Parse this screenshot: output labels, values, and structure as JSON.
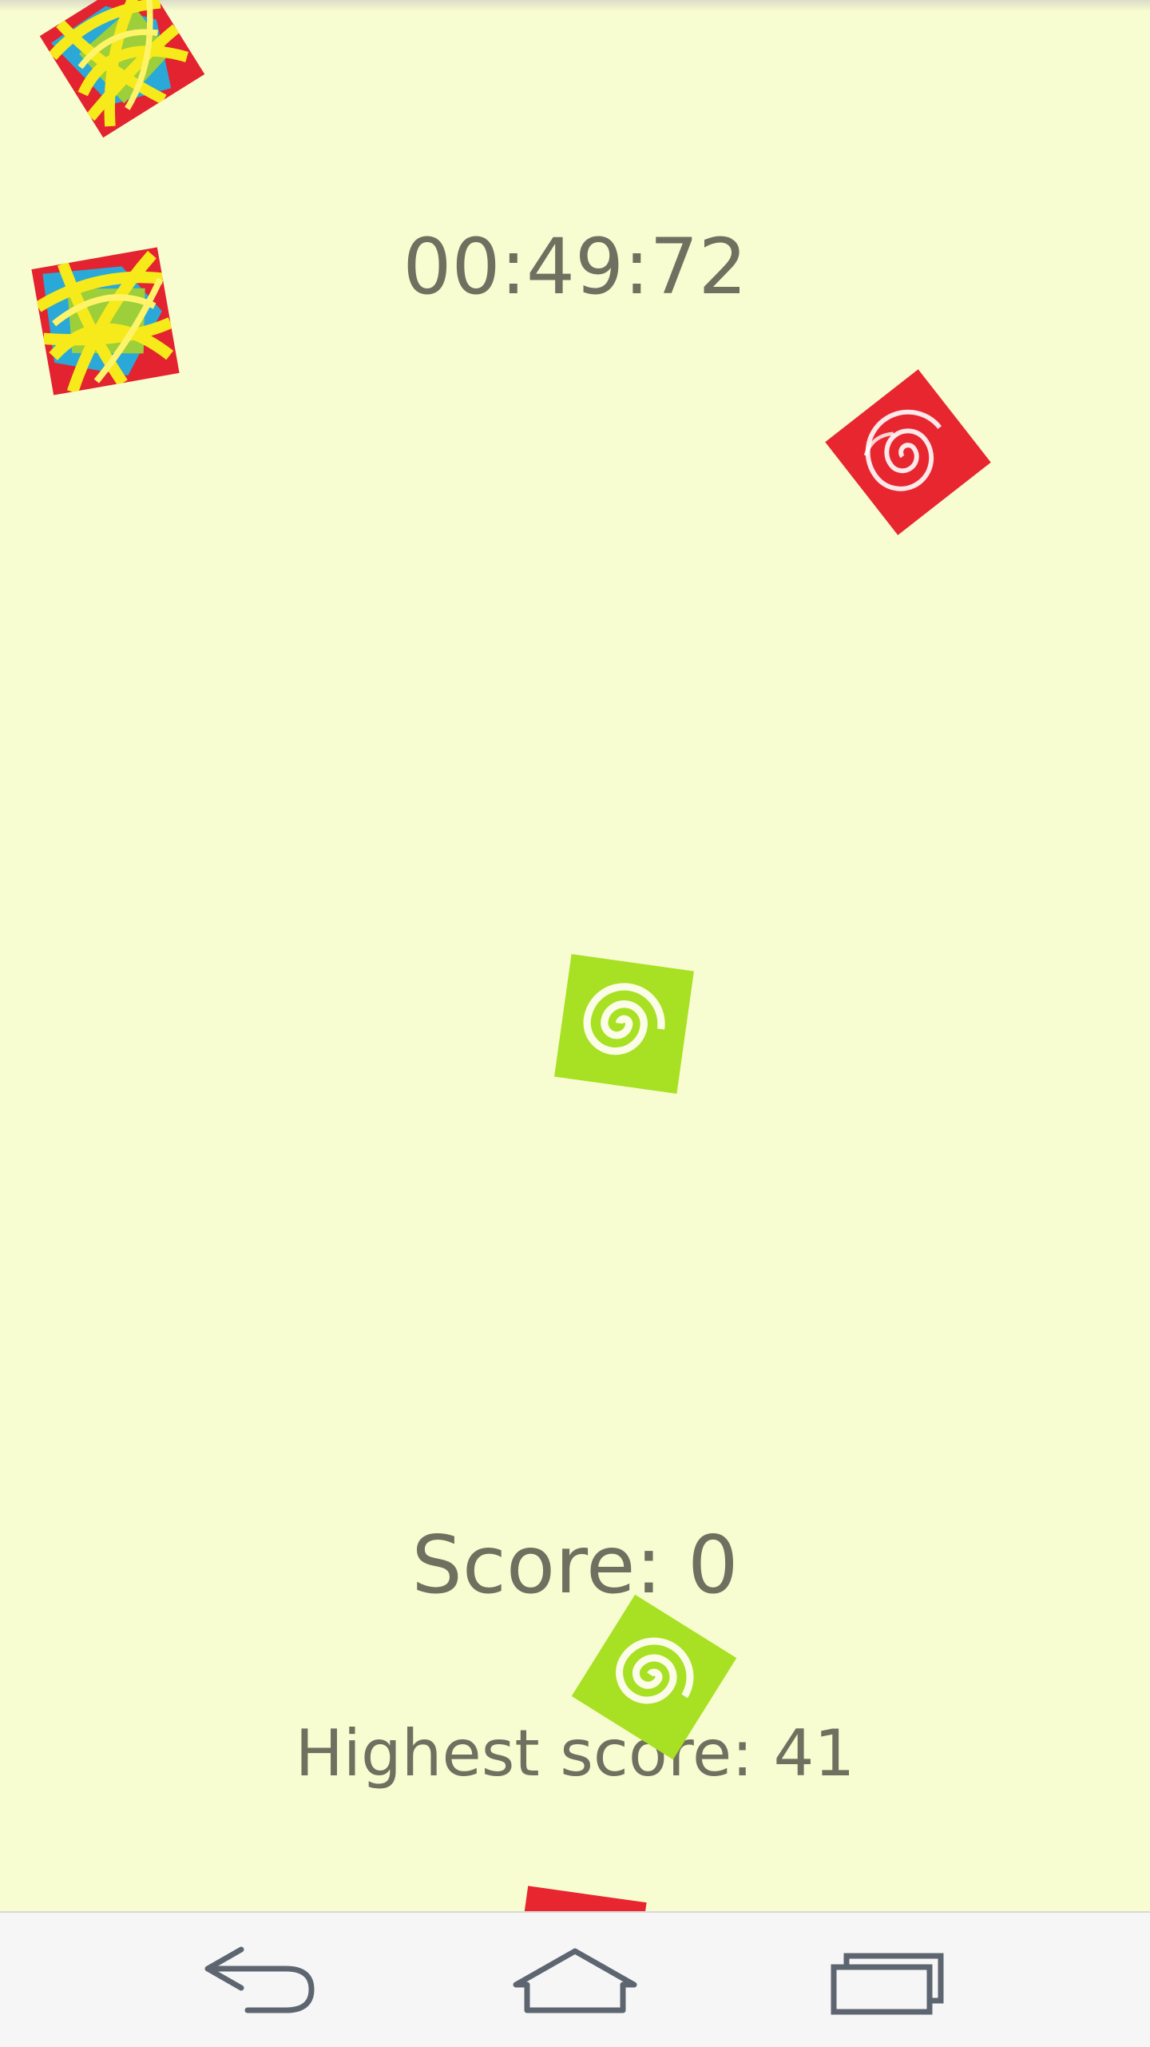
{
  "game": {
    "timer": "00:49:72",
    "score_text": "Score: 0",
    "highest_text": "Highest score: 41"
  },
  "tiles": [
    {
      "name": "scribble-tile-icon"
    },
    {
      "name": "scribble-tile-icon"
    },
    {
      "name": "red-rose-tile-icon"
    },
    {
      "name": "green-swirl-tile-icon"
    },
    {
      "name": "green-swirl-tile-icon"
    },
    {
      "name": "red-rose-tile-icon"
    }
  ],
  "navbar": {
    "icons": [
      "back-icon",
      "home-icon",
      "recent-apps-icon"
    ]
  },
  "colors": {
    "background": "#f7fdd0",
    "text": "#6f7060",
    "navbar": "#f6f6f6"
  }
}
